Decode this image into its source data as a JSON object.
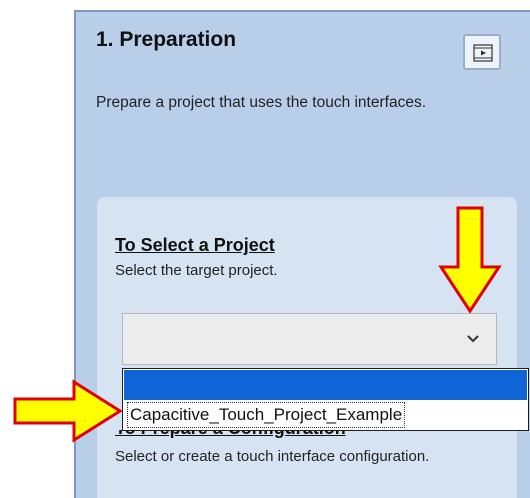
{
  "section": {
    "title": "1. Preparation",
    "video_icon": "video-play-icon",
    "description": "Prepare a project that uses the touch interfaces."
  },
  "select_project": {
    "heading": "To Select a Project",
    "text": "Select the target project.",
    "dropdown_value": "",
    "dropdown_icon": "chevron-down-icon",
    "options": [
      "",
      "Capacitive_Touch_Project_Example"
    ]
  },
  "configuration": {
    "heading": "To Prepare a Configuration",
    "text": "Select or create a touch interface configuration."
  },
  "annotations": {
    "arrow_color": "#ffff00",
    "arrow_border": "#e00000"
  },
  "colors": {
    "panel": "#b9cfe9",
    "inner": "#d6e3f3",
    "selection": "#0f64d6"
  }
}
